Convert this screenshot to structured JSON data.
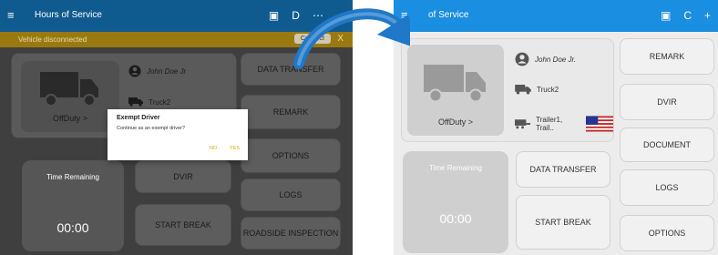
{
  "left": {
    "appbar": {
      "menu_icon": "≡",
      "title": "Hours of Service",
      "icon_glyphs": [
        "▣",
        "D",
        "⋯",
        "⇥"
      ]
    },
    "banner": {
      "text": "Vehicle disconnected",
      "reconnect": "Connect",
      "close": "X"
    },
    "driver": {
      "name": "John Doe Jr",
      "vehicle": "Truck2"
    },
    "status": "OffDuty  >",
    "dialog": {
      "title": "Exempt Driver",
      "message": "Continue as an exempt driver?",
      "no": "NO",
      "yes": "YES"
    },
    "time": {
      "label": "Time Remaining",
      "value": "00:00"
    },
    "buttons": {
      "data_transfer": "DATA TRANSFER",
      "remark": "REMARK",
      "options": "OPTIONS",
      "dvir": "DVIR",
      "logs": "LOGS",
      "start_break": "START BREAK",
      "roadside": "ROADSIDE INSPECTION"
    }
  },
  "right": {
    "appbar": {
      "menu_icon": "≡",
      "title": "of Service",
      "icon_glyphs": [
        "▣",
        "C",
        "+"
      ]
    },
    "driver": {
      "name": "John Doe Jr.",
      "vehicle": "Truck2",
      "trailers": "Trailer1, Trail.."
    },
    "status": "OffDuty  >",
    "time": {
      "label": "Time Remaining",
      "value": "00:00"
    },
    "buttons": {
      "remark": "REMARK",
      "dvir": "DVIR",
      "document": "DOCUMENT",
      "logs": "LOGS",
      "options": "OPTIONS",
      "data_transfer": "DATA TRANSFER",
      "start_break": "START BREAK"
    }
  },
  "colors": {
    "appbar_blue": "#1a8ee1",
    "arrow_blue": "#1f78c8",
    "banner": "#9a7a10"
  }
}
